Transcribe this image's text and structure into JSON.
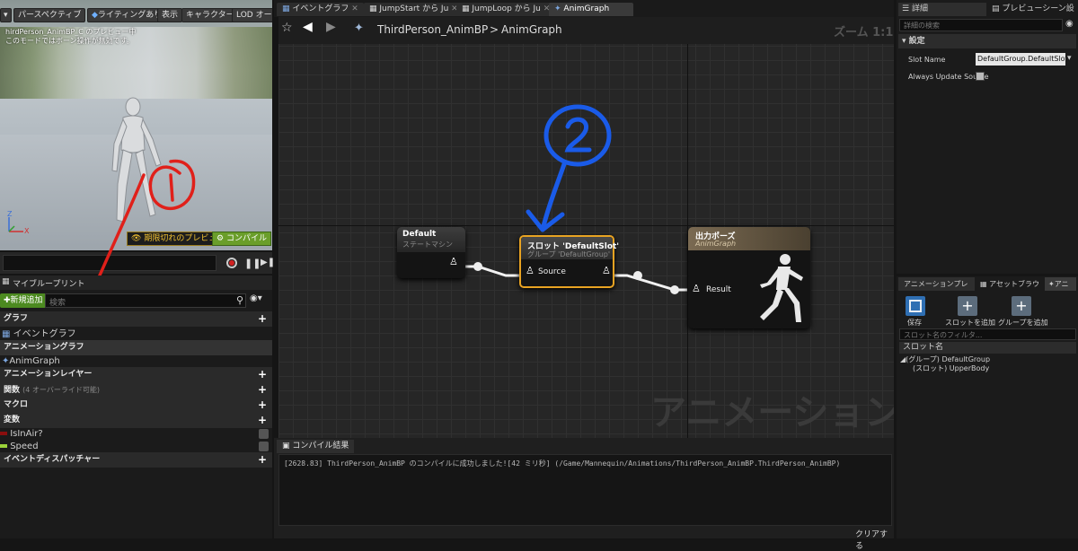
{
  "viewport": {
    "toolbar": [
      "パースペクティブ",
      "ライティングあり",
      "表示",
      "キャラクター",
      "LOD オート"
    ],
    "info_line1": "hirdPerson_AnimBP_C のプレビュー中",
    "info_line2": "このモードではボーン操作が無効です。",
    "axis_z": "Z",
    "axis_x": "X",
    "preview_badge": "期限切れのプレビュー",
    "compile_label": "コンパイル"
  },
  "annotations": {
    "one": "①",
    "two": "②"
  },
  "my_blueprint": {
    "tab_label": "マイブループリント",
    "add_new_label": "新規追加",
    "search_placeholder": "検索",
    "sections": {
      "graph": "グラフ",
      "event_graph": "イベントグラフ",
      "animation_graph": "アニメーショングラフ",
      "anim_graph": "AnimGraph",
      "anim_layer": "アニメーションレイヤー",
      "functions": "関数",
      "functions_note": "(4 オーバーライド可能)",
      "macros": "マクロ",
      "variables": "変数",
      "var_isinair": "IsInAir?",
      "var_speed": "Speed",
      "dispatchers": "イベントディスパッチャー"
    }
  },
  "tabs": [
    "イベントグラフ",
    "JumpStart から Ju",
    "JumpLoop から Ju",
    "AnimGraph"
  ],
  "graph": {
    "breadcrumb_root": "ThirdPerson_AnimBP",
    "breadcrumb_sep": ">",
    "breadcrumb_current": "AnimGraph",
    "zoom": "ズーム 1:1",
    "watermark": "アニメーション",
    "node_default_title": "Default",
    "node_default_sub": "ステートマシン",
    "node_slot_title": "スロット 'DefaultSlot'",
    "node_slot_sub": "グループ 'DefaultGroup'",
    "node_slot_pin": "Source",
    "node_output_title": "出力ポーズ",
    "node_output_sub": "AnimGraph",
    "node_output_pin": "Result"
  },
  "compiler": {
    "tab_label": "コンパイル結果",
    "message": "[2628.83] ThirdPerson_AnimBP のコンパイルに成功しました![42 ミリ秒] (/Game/Mannequin/Animations/ThirdPerson_AnimBP.ThirdPerson_AnimBP)",
    "clear_label": "クリアする"
  },
  "details": {
    "tab_label": "詳細",
    "tab2_label": "プレビューシーン設",
    "search_placeholder": "詳細の検索",
    "section": "設定",
    "slot_name_label": "Slot Name",
    "slot_name_value": "DefaultGroup.DefaultSlot",
    "always_update_label": "Always Update Source"
  },
  "slot_panel": {
    "tabs": [
      "アニメーションプレ",
      "アセットブラウ",
      "アニ"
    ],
    "save_label": "保存",
    "add_slot_label": "スロットを追加",
    "add_group_label": "グループを追加",
    "filter_placeholder": "スロット名のフィルタ...",
    "header": "スロット名",
    "group_item": "(グループ) DefaultGroup",
    "slot_item": "(スロット) UpperBody"
  },
  "colors": {
    "accent_orange": "#e8a322",
    "annotation_red": "#e0201a",
    "annotation_blue": "#1a5be8"
  }
}
